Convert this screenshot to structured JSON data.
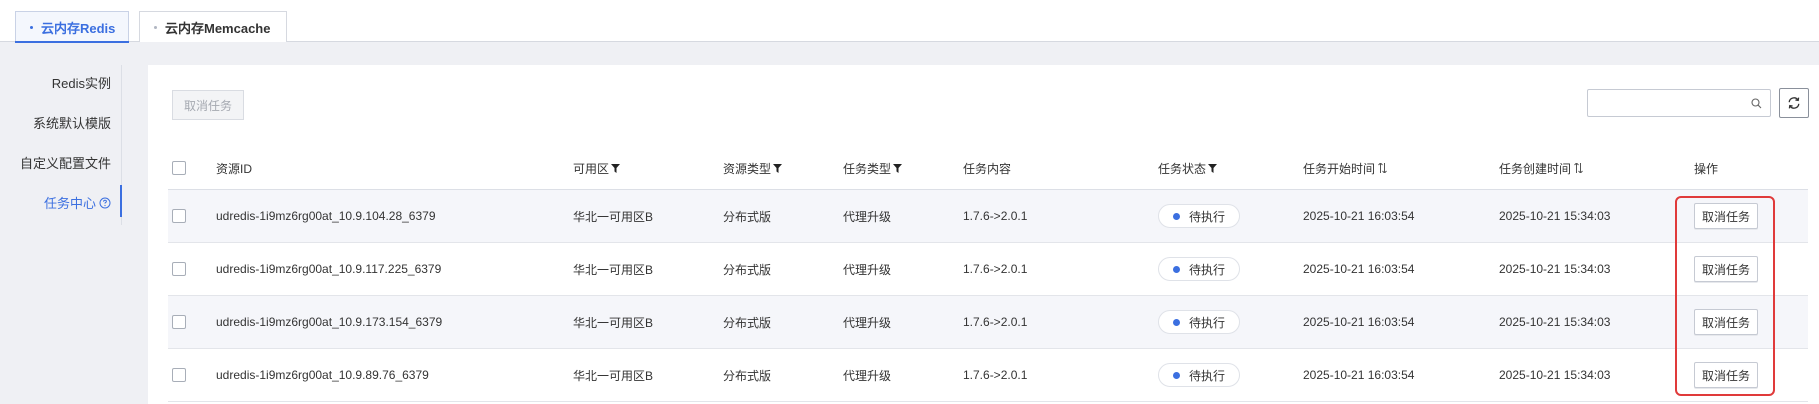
{
  "tabs": [
    {
      "label": "云内存Redis",
      "active": true
    },
    {
      "label": "云内存Memcache",
      "active": false
    }
  ],
  "sidebar": {
    "items": [
      {
        "label": "Redis实例"
      },
      {
        "label": "系统默认模版"
      },
      {
        "label": "自定义配置文件"
      },
      {
        "label": "任务中心",
        "active": true
      }
    ]
  },
  "toolbar": {
    "cancel_task_label": "取消任务",
    "search_placeholder": ""
  },
  "table": {
    "columns": {
      "resource_id": "资源ID",
      "zone": "可用区",
      "resource_type": "资源类型",
      "task_type": "任务类型",
      "task_content": "任务内容",
      "task_status": "任务状态",
      "start_time": "任务开始时间",
      "create_time": "任务创建时间",
      "actions": "操作"
    },
    "rows": [
      {
        "resource_id": "udredis-1i9mz6rg00at_10.9.104.28_6379",
        "zone": "华北一可用区B",
        "resource_type": "分布式版",
        "task_type": "代理升级",
        "task_content": "1.7.6->2.0.1",
        "task_status": "待执行",
        "start_time": "2025-10-21 16:03:54",
        "create_time": "2025-10-21 15:34:03",
        "action": "取消任务"
      },
      {
        "resource_id": "udredis-1i9mz6rg00at_10.9.117.225_6379",
        "zone": "华北一可用区B",
        "resource_type": "分布式版",
        "task_type": "代理升级",
        "task_content": "1.7.6->2.0.1",
        "task_status": "待执行",
        "start_time": "2025-10-21 16:03:54",
        "create_time": "2025-10-21 15:34:03",
        "action": "取消任务"
      },
      {
        "resource_id": "udredis-1i9mz6rg00at_10.9.173.154_6379",
        "zone": "华北一可用区B",
        "resource_type": "分布式版",
        "task_type": "代理升级",
        "task_content": "1.7.6->2.0.1",
        "task_status": "待执行",
        "start_time": "2025-10-21 16:03:54",
        "create_time": "2025-10-21 15:34:03",
        "action": "取消任务"
      },
      {
        "resource_id": "udredis-1i9mz6rg00at_10.9.89.76_6379",
        "zone": "华北一可用区B",
        "resource_type": "分布式版",
        "task_type": "代理升级",
        "task_content": "1.7.6->2.0.1",
        "task_status": "待执行",
        "start_time": "2025-10-21 16:03:54",
        "create_time": "2025-10-21 15:34:03",
        "action": "取消任务"
      }
    ]
  },
  "colors": {
    "accent": "#3b6fe0",
    "highlight": "#e03a3a"
  }
}
